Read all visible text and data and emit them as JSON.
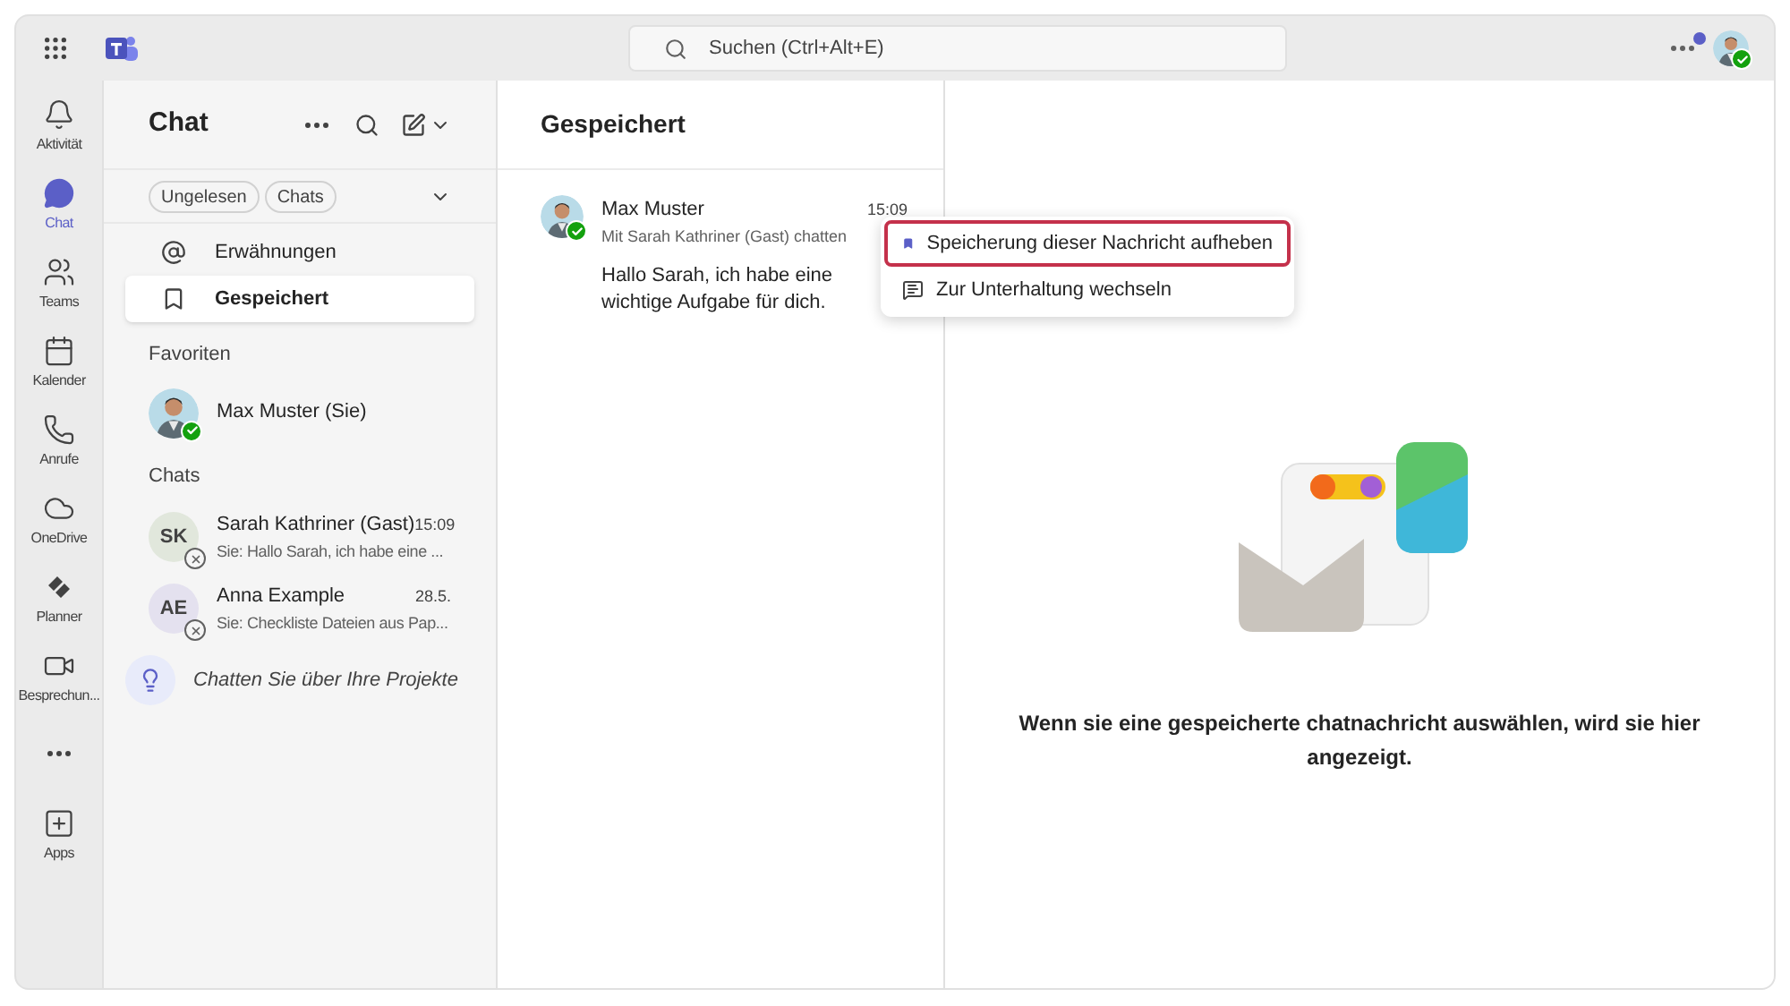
{
  "top_bar": {
    "search_placeholder": "Suchen (Ctrl+Alt+E)",
    "notification_dot": true,
    "available": true
  },
  "app_rail": [
    {
      "label": "Aktivität",
      "kind": "activity",
      "selected": false
    },
    {
      "label": "Chat",
      "kind": "chat",
      "selected": true
    },
    {
      "label": "Teams",
      "kind": "teams",
      "selected": false
    },
    {
      "label": "Kalender",
      "kind": "calendar",
      "selected": false
    },
    {
      "label": "Anrufe",
      "kind": "calls",
      "selected": false
    },
    {
      "label": "OneDrive",
      "kind": "onedrive",
      "selected": false
    },
    {
      "label": "Planner",
      "kind": "planner",
      "selected": false
    },
    {
      "label": "Besprechun...",
      "kind": "meetings",
      "selected": false
    },
    {
      "kind": "more",
      "selected": false
    },
    {
      "label": "Apps",
      "kind": "apps",
      "selected": false
    }
  ],
  "chat_panel": {
    "title": "Chat",
    "filters": [
      {
        "label": "Ungelesen",
        "selected": false
      },
      {
        "label": "Chats",
        "selected": false
      }
    ],
    "nav": [
      {
        "label": "Erwähnungen",
        "kind": "mentions",
        "selected": false
      },
      {
        "label": "Gespeichert",
        "kind": "saved",
        "selected": true
      }
    ],
    "favorites_heading": "Favoriten",
    "favorites": [
      {
        "name": "Max Muster (Sie)",
        "available": true
      }
    ],
    "chats_heading": "Chats",
    "chats": [
      {
        "initials": "SK",
        "color": "#e1e7dc",
        "name": "Sarah Kathriner (Gast)",
        "time": "15:09",
        "preview": "Sie: Hallo Sarah, ich habe eine ...",
        "available": false
      },
      {
        "initials": "AE",
        "color": "#e4e1ef",
        "name": "Anna Example",
        "time": "28.5.",
        "preview": "Sie: Checkliste Dateien aus Pap...",
        "available": false
      }
    ],
    "suggestion": "Chatten Sie über Ihre Projekte"
  },
  "saved_pane": {
    "title": "Gespeichert",
    "message": {
      "sender": "Max Muster",
      "context": "Mit Sarah Kathriner (Gast) chatten",
      "time": "15:09",
      "text": "Hallo Sarah, ich habe eine wichtige Aufgabe für dich.",
      "available": true
    },
    "menu": [
      {
        "label": "Speicherung dieser Nachricht aufheben",
        "kind": "unsave",
        "selected": true
      },
      {
        "label": "Zur Unterhaltung wechseln",
        "kind": "goto",
        "selected": false
      }
    ]
  },
  "empty_state": {
    "text": "Wenn sie eine gespeicherte chatnachricht auswählen, wird sie hier angezeigt."
  }
}
